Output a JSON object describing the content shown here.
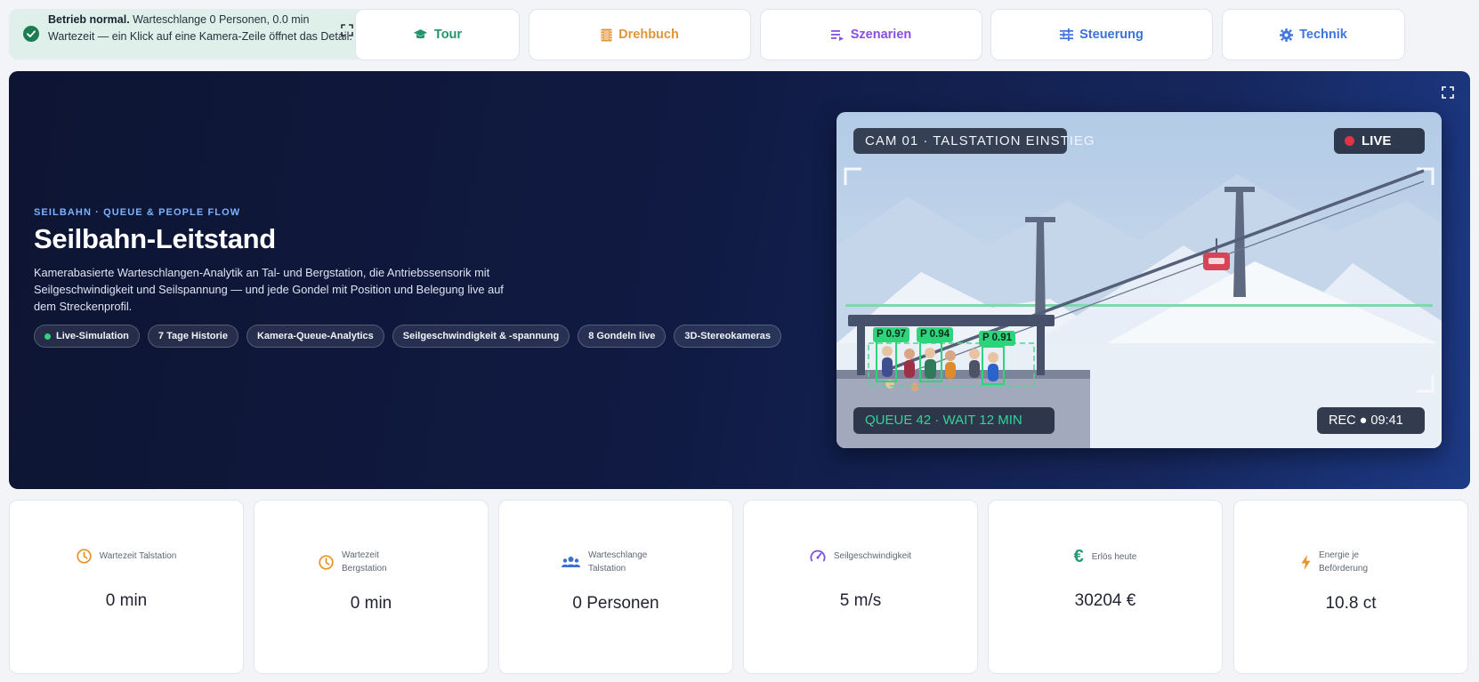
{
  "status": {
    "title": "Betrieb normal.",
    "text": " Warteschlange 0 Personen, 0.0 min Wartezeit — ein Klick auf eine Kamera-Zeile öffnet das Detail."
  },
  "nav": {
    "tour": "Tour",
    "drehbuch": "Drehbuch",
    "szenarien": "Szenarien",
    "steuerung": "Steuerung",
    "technik": "Technik"
  },
  "colors": {
    "tour": "#23936b",
    "drehbuch": "#e0953a",
    "szenarien": "#8a4fe0",
    "steuerung": "#3a72d8",
    "technik": "#3e76dc"
  },
  "hero": {
    "eyebrow": "SEILBAHN · QUEUE & PEOPLE FLOW",
    "title": "Seilbahn-Leitstand",
    "description": "Kamerabasierte Warteschlangen-Analytik an Tal- und Bergstation, die Antriebssensorik mit Seilgeschwindigkeit und Seilspannung — und jede Gondel mit Position und Belegung live auf dem Streckenprofil.",
    "chips": [
      "Live-Simulation",
      "7 Tage Historie",
      "Kamera-Queue-Analytics",
      "Seilgeschwindigkeit & -spannung",
      "8 Gondeln live",
      "3D-Stereokameras"
    ]
  },
  "camera": {
    "title": "CAM 01 · TALSTATION EINSTIEG",
    "live": "LIVE",
    "queue": "QUEUE 42 · WAIT 12 MIN",
    "rec": "REC ● 09:41",
    "detections": [
      "P 0.97",
      "P 0.94",
      "P 0.91"
    ]
  },
  "kpis": [
    {
      "icon": "clock-icon",
      "label": "Wartezeit Talstation",
      "value": "0 min"
    },
    {
      "icon": "clock-icon",
      "label": "Wartezeit Bergstation",
      "value": "0 min"
    },
    {
      "icon": "people-icon",
      "label": "Warteschlange Talstation",
      "value": "0 Personen"
    },
    {
      "icon": "speedometer-icon",
      "label": "Seilgeschwindigkeit",
      "value": "5 m/s"
    },
    {
      "icon": "euro-icon",
      "label": "Erlös heute",
      "value": "30204 €"
    },
    {
      "icon": "bolt-icon",
      "label": "Energie je Beförderung",
      "value": "10.8 ct"
    }
  ]
}
